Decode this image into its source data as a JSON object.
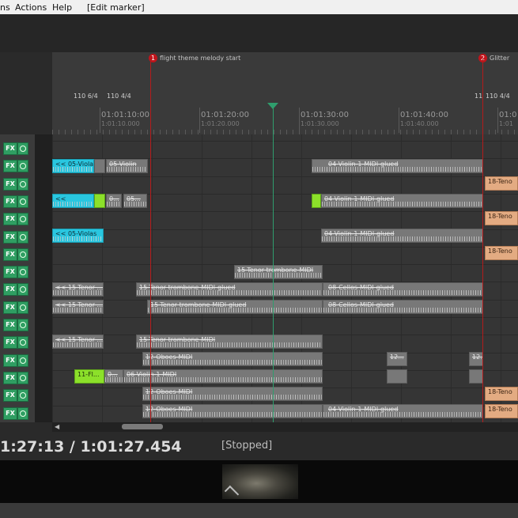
{
  "menu": {
    "items": [
      "ns",
      "Actions",
      "Help",
      "[Edit marker]"
    ]
  },
  "markers": [
    {
      "num": "1",
      "label": "flight theme melody start"
    },
    {
      "num": "2",
      "label": "Glitter"
    }
  ],
  "tempo": [
    "110 6/4",
    "110 4/4",
    "11",
    "110 4/4"
  ],
  "ruler": [
    {
      "main": "01:01:10:00",
      "sub": "1:01:10.000"
    },
    {
      "main": "01:01:20:00",
      "sub": "1:01:20.000"
    },
    {
      "main": "01:01:30:00",
      "sub": "1:01:30.000"
    },
    {
      "main": "01:01:40:00",
      "sub": "1:01:40.000"
    },
    {
      "main": "01:0",
      "sub": "1:01"
    }
  ],
  "track_controls": {
    "fx_label": "FX",
    "count": 16
  },
  "clips": {
    "c0": "<< 05-Viola...",
    "c1": "05-Violin",
    "c2": "04-Violin-1-MIDI-glued",
    "c3": "18-Teno",
    "c4": "<<",
    "c5": "0...",
    "c6": "05...",
    "c7": "04-Violin-1-MIDI-glued",
    "c8": "18-Teno",
    "c9": "<< 05-Violas",
    "c10": "04-Violin-1-MIDI-glued",
    "c11": "18-Teno",
    "c12": "15-Tenor trombone-MIDI",
    "c13": "<< 15-Tenor ...",
    "c14": "15-Tenor trombone-MIDI-glued",
    "c15": "08-Cellos-MIDI-glued",
    "c16": "<< 15-Tenor ...",
    "c17": "15-Tenor trombone-MIDI-glued",
    "c18": "08-Cellos-MIDI-glued",
    "c19": "<< 15-Tenor ...",
    "c20": "15-Tenor trombone-MIDI",
    "c21": "12-Oboes-MIDI",
    "c22": "12...",
    "c23": "12...",
    "c24": "11-Fl...",
    "c25": "0...",
    "c26": "06-Violin-1-MIDI",
    "c27": "12-Oboes-MIDI",
    "c28": "18-Teno",
    "c29": "12-Oboes-MIDI",
    "c30": "04-Violin-1-MIDI-glued",
    "c31": "18-Teno"
  },
  "transport": {
    "time": "1:27:13 / 1:01:27.454",
    "state": "[Stopped]"
  },
  "colors": {
    "accent_green": "#2f9e62",
    "marker_red": "#c0141b",
    "clip_cyan": "#29c7e0",
    "clip_lime": "#8ce02a",
    "clip_orange": "#e3ab82"
  }
}
